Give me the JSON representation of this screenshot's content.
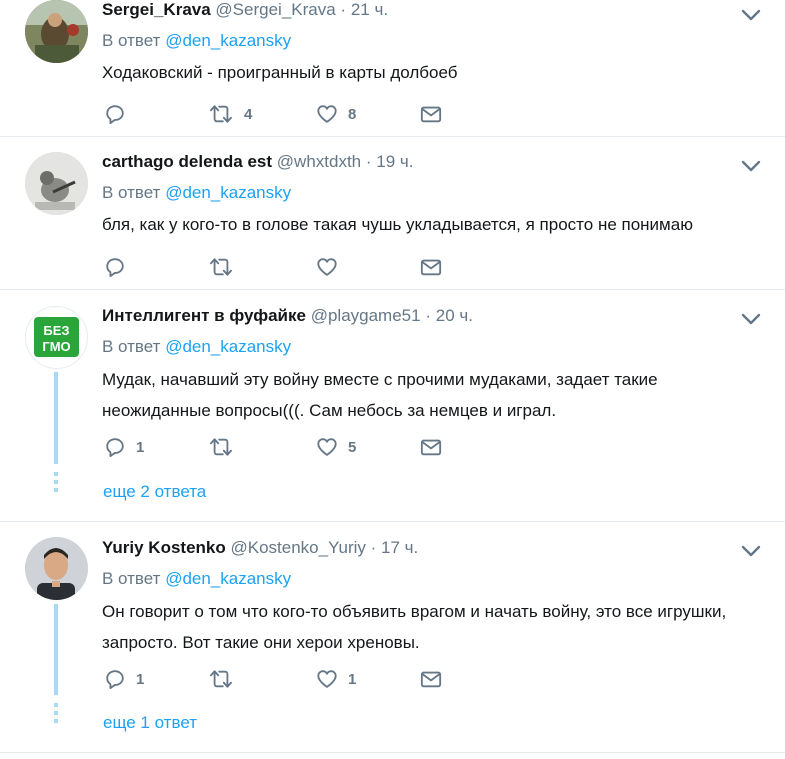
{
  "tweets": [
    {
      "name": "Sergei_Krava",
      "handle": "@Sergei_Krava",
      "time": "21 ч.",
      "reply_prefix": "В ответ",
      "reply_to": "@den_kazansky",
      "text": "Ходаковский - проигранный в карты долбоеб",
      "replies": "",
      "retweets": "4",
      "likes": "8"
    },
    {
      "name": "carthago delenda est",
      "handle": "@whxtdxth",
      "time": "19 ч.",
      "reply_prefix": "В ответ",
      "reply_to": "@den_kazansky",
      "text": "бля, как у кого-то в голове такая чушь укладывается, я просто не понимаю",
      "replies": "",
      "retweets": "",
      "likes": ""
    },
    {
      "name": "Интеллигент в фуфайке",
      "handle": "@playgame51",
      "time": "20 ч.",
      "reply_prefix": "В ответ",
      "reply_to": "@den_kazansky",
      "text": "Мудак, начавший эту войну вместе с прочими мудаками, задает такие неожиданные вопросы(((. Сам небось за немцев и играл.",
      "replies": "1",
      "retweets": "",
      "likes": "5",
      "more": "еще 2 ответа",
      "avatar_text_1": "БЕЗ",
      "avatar_text_2": "ГМО"
    },
    {
      "name": "Yuriy Kostenko",
      "handle": "@Kostenko_Yuriy",
      "time": "17 ч.",
      "reply_prefix": "В ответ",
      "reply_to": "@den_kazansky",
      "text": "Он говорит о том что кого-то объявить врагом и начать войну, это все игрушки, запросто. Вот такие они херои хреновы.",
      "replies": "1",
      "retweets": "",
      "likes": "1",
      "more": "еще 1 ответ"
    }
  ],
  "colors": {
    "link": "#1da1f2",
    "secondary": "#657786",
    "thread": "#a9d9f9",
    "border": "#e6ecf0"
  },
  "icons": [
    "reply-icon",
    "retweet-icon",
    "like-icon",
    "direct-message-icon",
    "chevron-down-icon"
  ]
}
